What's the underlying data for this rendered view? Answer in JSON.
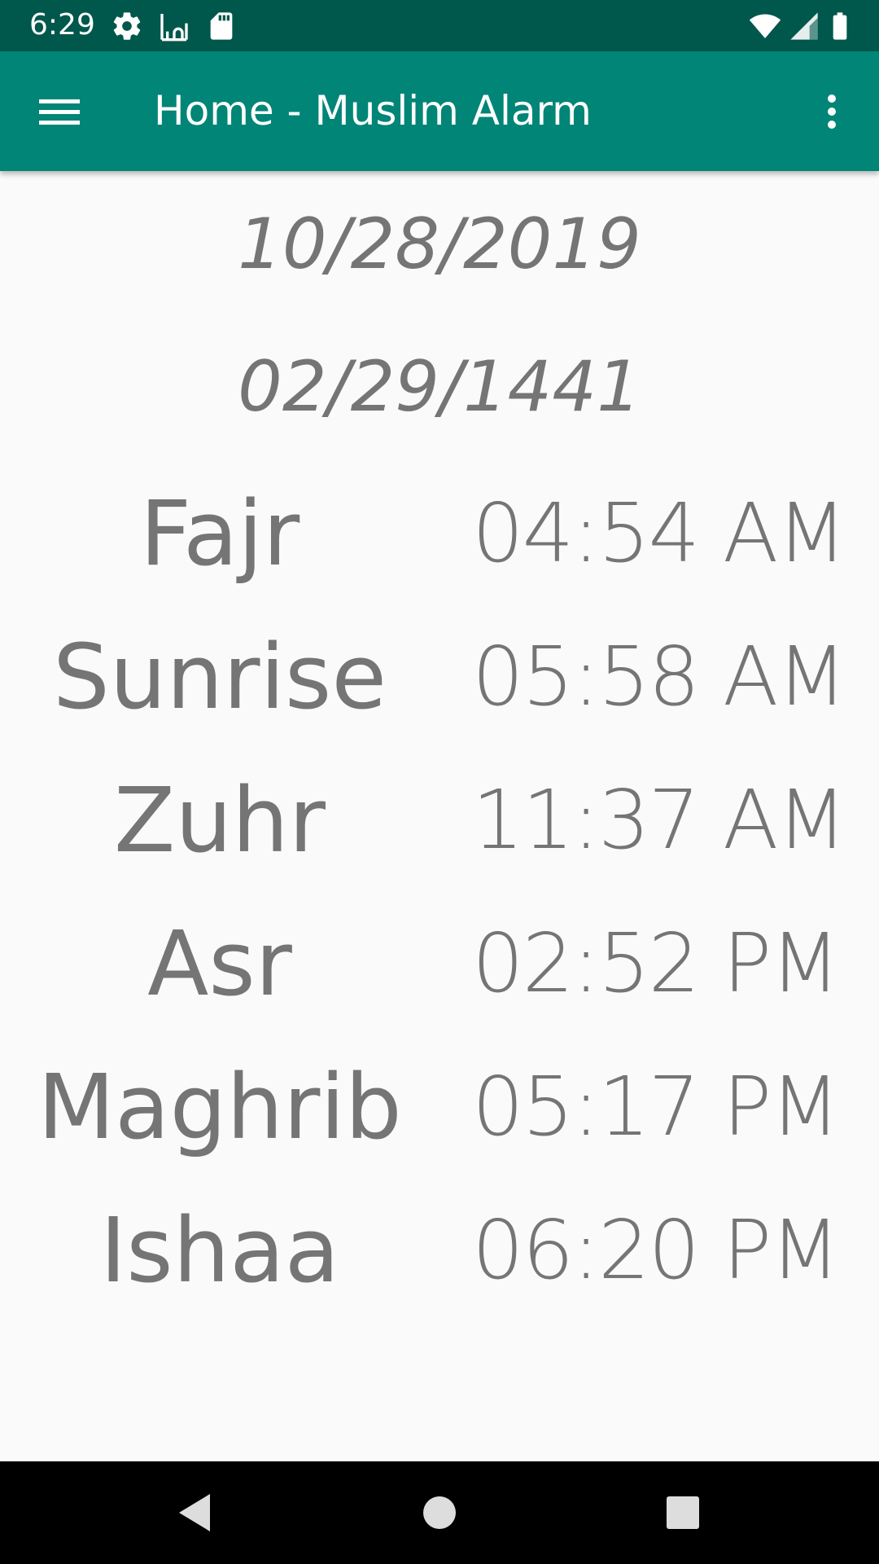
{
  "status_bar": {
    "time": "6:29",
    "icons": [
      "gear-icon",
      "mosque-icon",
      "sd-card-icon",
      "wifi-icon",
      "cell-signal-icon",
      "battery-icon"
    ]
  },
  "app_bar": {
    "title": "Home - Muslim Alarm",
    "color": "#008577",
    "status_color": "#00574b",
    "menu_icon": "hamburger-menu-icon",
    "overflow_icon": "more-vert-icon"
  },
  "dates": {
    "gregorian": "10/28/2019",
    "hijri": "02/29/1441"
  },
  "prayers": [
    {
      "name": "Fajr",
      "time": "04:54 AM"
    },
    {
      "name": "Sunrise",
      "time": "05:58 AM"
    },
    {
      "name": "Zuhr",
      "time": "11:37 AM"
    },
    {
      "name": "Asr",
      "time": "02:52 PM"
    },
    {
      "name": "Maghrib",
      "time": "05:17 PM"
    },
    {
      "name": "Ishaa",
      "time": "06:20 PM"
    }
  ],
  "nav_bar": {
    "icons": [
      "back-icon",
      "home-icon",
      "recents-icon"
    ]
  }
}
